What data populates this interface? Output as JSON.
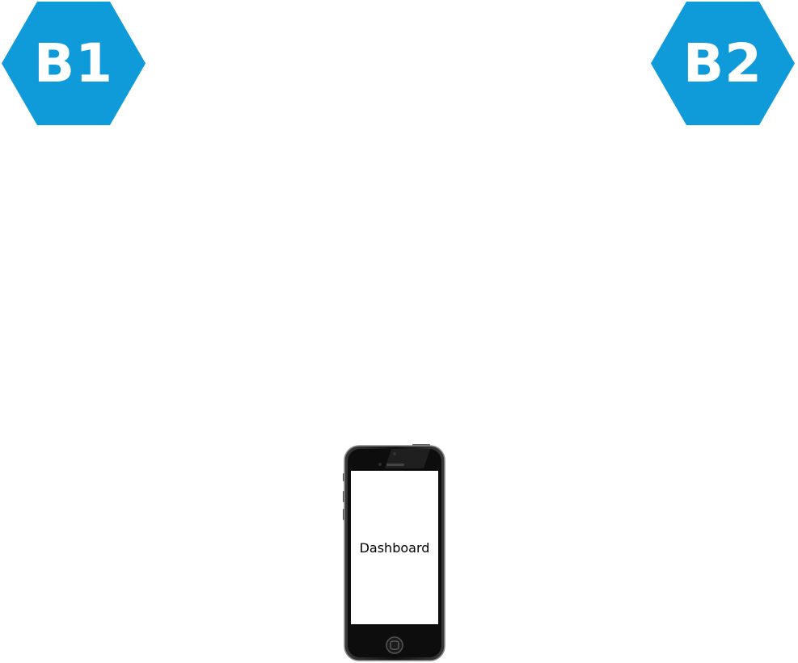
{
  "nodes": [
    {
      "id": "b1",
      "label": "B1"
    },
    {
      "id": "b2",
      "label": "B2"
    }
  ],
  "phone": {
    "screen_label": "Dashboard"
  },
  "colors": {
    "hexagon_fill": "#0f9ad9",
    "hexagon_text": "#ffffff",
    "phone_body": "#1a1a1a",
    "screen": "#ffffff"
  }
}
